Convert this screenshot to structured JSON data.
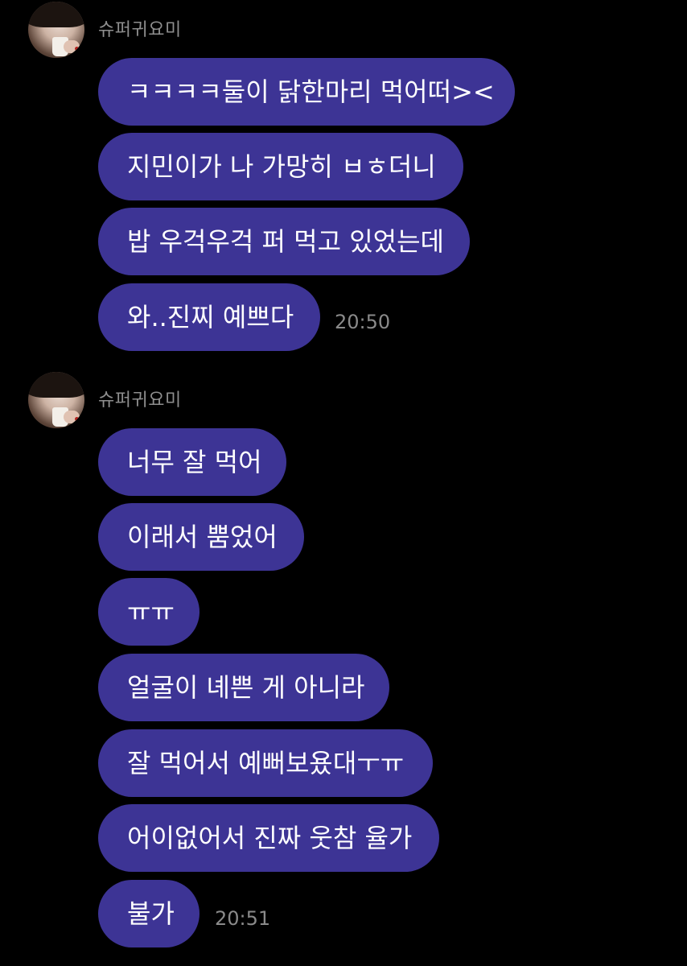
{
  "groups": [
    {
      "sender": "슈퍼귀요미",
      "messages": [
        "ㅋㅋㅋㅋ둘이 닭한마리 먹어떠><",
        "지민이가 나 가망히 ㅂㅎ더니",
        "밥 우걱우걱 퍼 먹고 있었는데",
        "와..진찌 예쁘다"
      ],
      "time": "20:50"
    },
    {
      "sender": "슈퍼귀요미",
      "messages": [
        "너무 잘 먹어",
        "이래서 뿜었어",
        "ㅠㅠ",
        "얼굴이 녜쁜 게 아니라",
        "잘 먹어서 예뻐보욨대ㅜㅠ",
        "어이없어서 진짜 웃참 율가",
        "불가"
      ],
      "time": "20:51"
    }
  ],
  "colors": {
    "background": "#000000",
    "bubble": "#3d3495",
    "bubble_text": "#ffffff",
    "meta_text": "#8e8e8e"
  }
}
